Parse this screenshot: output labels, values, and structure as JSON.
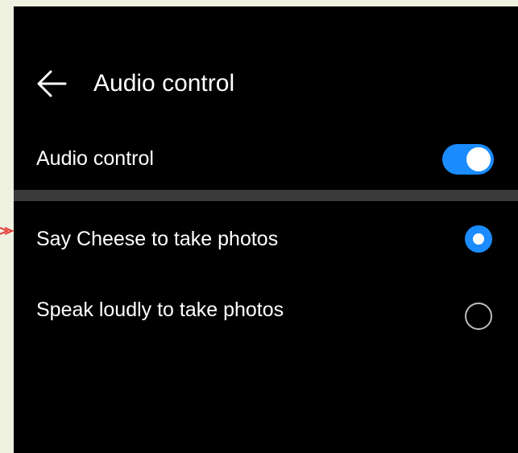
{
  "header": {
    "title": "Audio control",
    "back_icon": "arrow-left-icon"
  },
  "audio_control": {
    "label": "Audio control",
    "enabled": true,
    "accent": "#1a8cff"
  },
  "options": [
    {
      "label": "Say Cheese to take photos",
      "selected": true
    },
    {
      "label": "Speak loudly to take photos",
      "selected": false
    }
  ],
  "colors": {
    "background": "#000000",
    "text": "#ffffff",
    "divider": "#3a3a3a",
    "accent": "#1a8cff",
    "pointer_arrow": "#e53935"
  }
}
